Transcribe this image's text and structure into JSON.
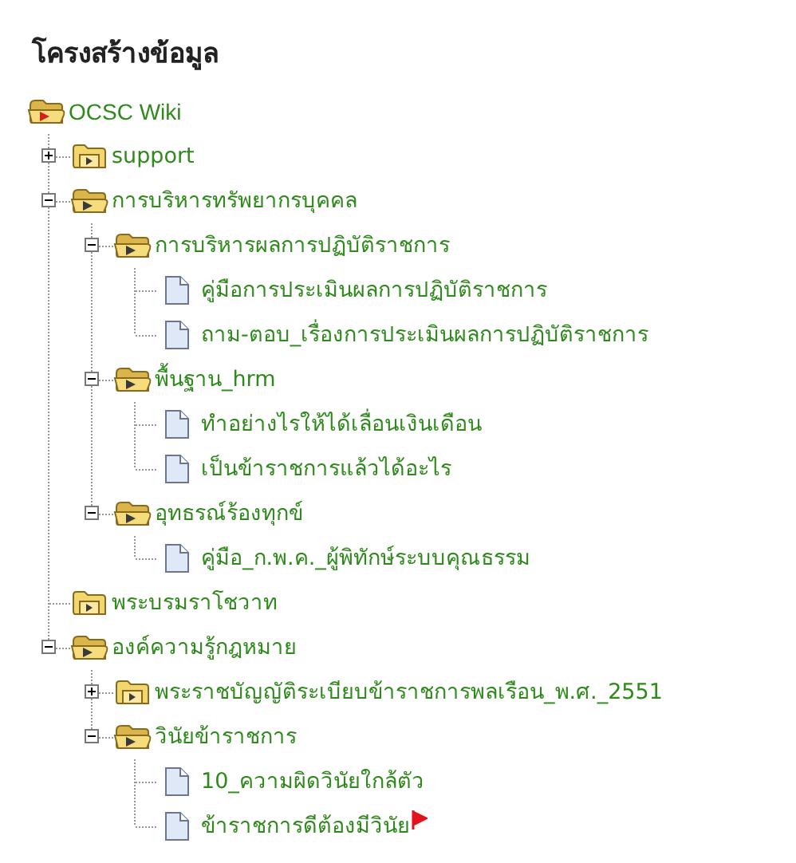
{
  "title": "โครงสร้างข้อมูล",
  "tree": {
    "label": "OCSC Wiki",
    "kind": "folder",
    "expanded": true,
    "children": [
      {
        "label": "support",
        "kind": "folder",
        "expanded": false,
        "collapsible": true
      },
      {
        "label": "การบริหารทรัพยากรบุคคล",
        "kind": "folder",
        "expanded": true,
        "collapsible": true,
        "children": [
          {
            "label": "การบริหารผลการปฏิบัติราชการ",
            "kind": "folder",
            "expanded": true,
            "collapsible": true,
            "children": [
              {
                "label": "คู่มือการประเมินผลการปฏิบัติราชการ",
                "kind": "page",
                "flagged": false
              },
              {
                "label": "ถาม-ตอบ_เรื่องการประเมินผลการปฏิบัติราชการ",
                "kind": "page",
                "flagged": false
              }
            ]
          },
          {
            "label": "พื้นฐาน_hrm",
            "kind": "folder",
            "expanded": true,
            "collapsible": true,
            "children": [
              {
                "label": "ทำอย่างไรให้ได้เลื่อนเงินเดือน",
                "kind": "page",
                "flagged": false
              },
              {
                "label": "เป็นข้าราชการแล้วได้อะไร",
                "kind": "page",
                "flagged": false
              }
            ]
          },
          {
            "label": "อุทธรณ์ร้องทุกข์",
            "kind": "folder",
            "expanded": true,
            "collapsible": true,
            "children": [
              {
                "label": "คู่มือ_ก.พ.ค._ผู้พิทักษ์ระบบคุณธรรม",
                "kind": "page",
                "flagged": false
              }
            ]
          }
        ]
      },
      {
        "label": "พระบรมราโชวาท",
        "kind": "folder",
        "expanded": false,
        "collapsible": false
      },
      {
        "label": "องค์ความรู้กฎหมาย",
        "kind": "folder",
        "expanded": true,
        "collapsible": true,
        "children": [
          {
            "label": "พระราชบัญญัติระเบียบข้าราชการพลเรือน_พ.ศ._2551",
            "kind": "folder",
            "expanded": false,
            "collapsible": true
          },
          {
            "label": "วินัยข้าราชการ",
            "kind": "folder",
            "expanded": true,
            "collapsible": true,
            "children": [
              {
                "label": "10_ความผิดวินัยใกล้ตัว",
                "kind": "page",
                "flagged": false
              },
              {
                "label": "ข้าราชการดีต้องมีวินัย",
                "kind": "page",
                "flagged": true
              }
            ]
          }
        ]
      }
    ]
  }
}
